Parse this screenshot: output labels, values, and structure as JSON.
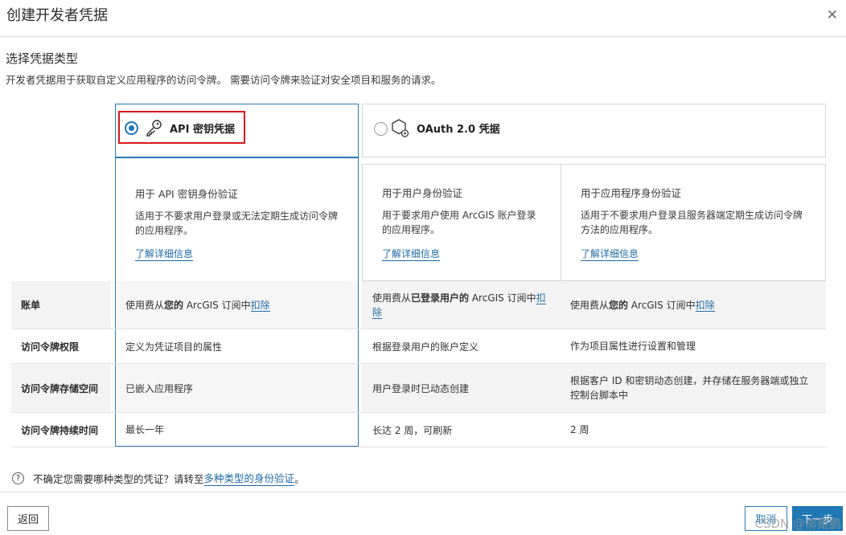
{
  "dialog": {
    "title": "创建开发者凭据",
    "close": "✕"
  },
  "section": {
    "title": "选择凭据类型",
    "description": "开发者凭据用于获取自定义应用程序的访问令牌。 需要访问令牌来验证对安全项目和服务的请求。"
  },
  "options": {
    "api_key": {
      "label": "API 密钥凭据",
      "selected": true,
      "icon": "key-icon"
    },
    "oauth": {
      "label": "OAuth 2.0 凭据",
      "selected": false,
      "icon": "oauth-app-icon"
    }
  },
  "descriptions": [
    {
      "title": "用于 API 密钥身份验证",
      "body_lines": [
        "适用于不要求用户登录或无法定期生成访问令牌",
        "的应用程序。"
      ],
      "link": "了解详细信息"
    },
    {
      "title": "用于用户身份验证",
      "body_lines": [
        "用于要求用户使用 ArcGIS 账户登录",
        "的应用程序。"
      ],
      "link": "了解详细信息"
    },
    {
      "title": "用于应用程序身份验证",
      "body_lines": [
        "适用于不要求用户登录且服务器端定期生成访问令牌",
        "方法的应用程序。"
      ],
      "link": "了解详细信息"
    }
  ],
  "comparison": {
    "billing": {
      "label": "账单",
      "api_pre": "使用费从",
      "api_bold": "您的",
      "api_mid": " ArcGIS 订阅中",
      "api_link": "扣除",
      "user_pre": "使用费从",
      "user_bold": "已登录用户的",
      "user_mid": " ArcGIS 订阅中",
      "user_link": "扣除",
      "app_pre": "使用费从",
      "app_bold": "您的",
      "app_mid": " ArcGIS 订阅中",
      "app_link": "扣除"
    },
    "rows": [
      {
        "label": "访问令牌权限",
        "api": "定义为凭证项目的属性",
        "user": "根据登录用户的账户定义",
        "app": "作为项目属性进行设置和管理"
      },
      {
        "label": "访问令牌存储空间",
        "api": "已嵌入应用程序",
        "user": "用户登录时已动态创建",
        "app": "根据客户 ID 和密钥动态创建，并存储在服务器端或独立控制台脚本中"
      },
      {
        "label": "访问令牌持续时间",
        "api": "最长一年",
        "user": "长达 2 周，可刷新",
        "app": "2 周"
      }
    ]
  },
  "help": {
    "icon": "?",
    "prefix": "不确定您需要哪种类型的凭证？请转至",
    "link": "多种类型的身份验证",
    "suffix": "。"
  },
  "footer": {
    "back": "返回",
    "cancel": "取消",
    "next": "下一步"
  },
  "watermark": "CSDN @柳鲲鹏",
  "colors": {
    "accent": "#1f77b4",
    "highlight": "#d7191c"
  }
}
